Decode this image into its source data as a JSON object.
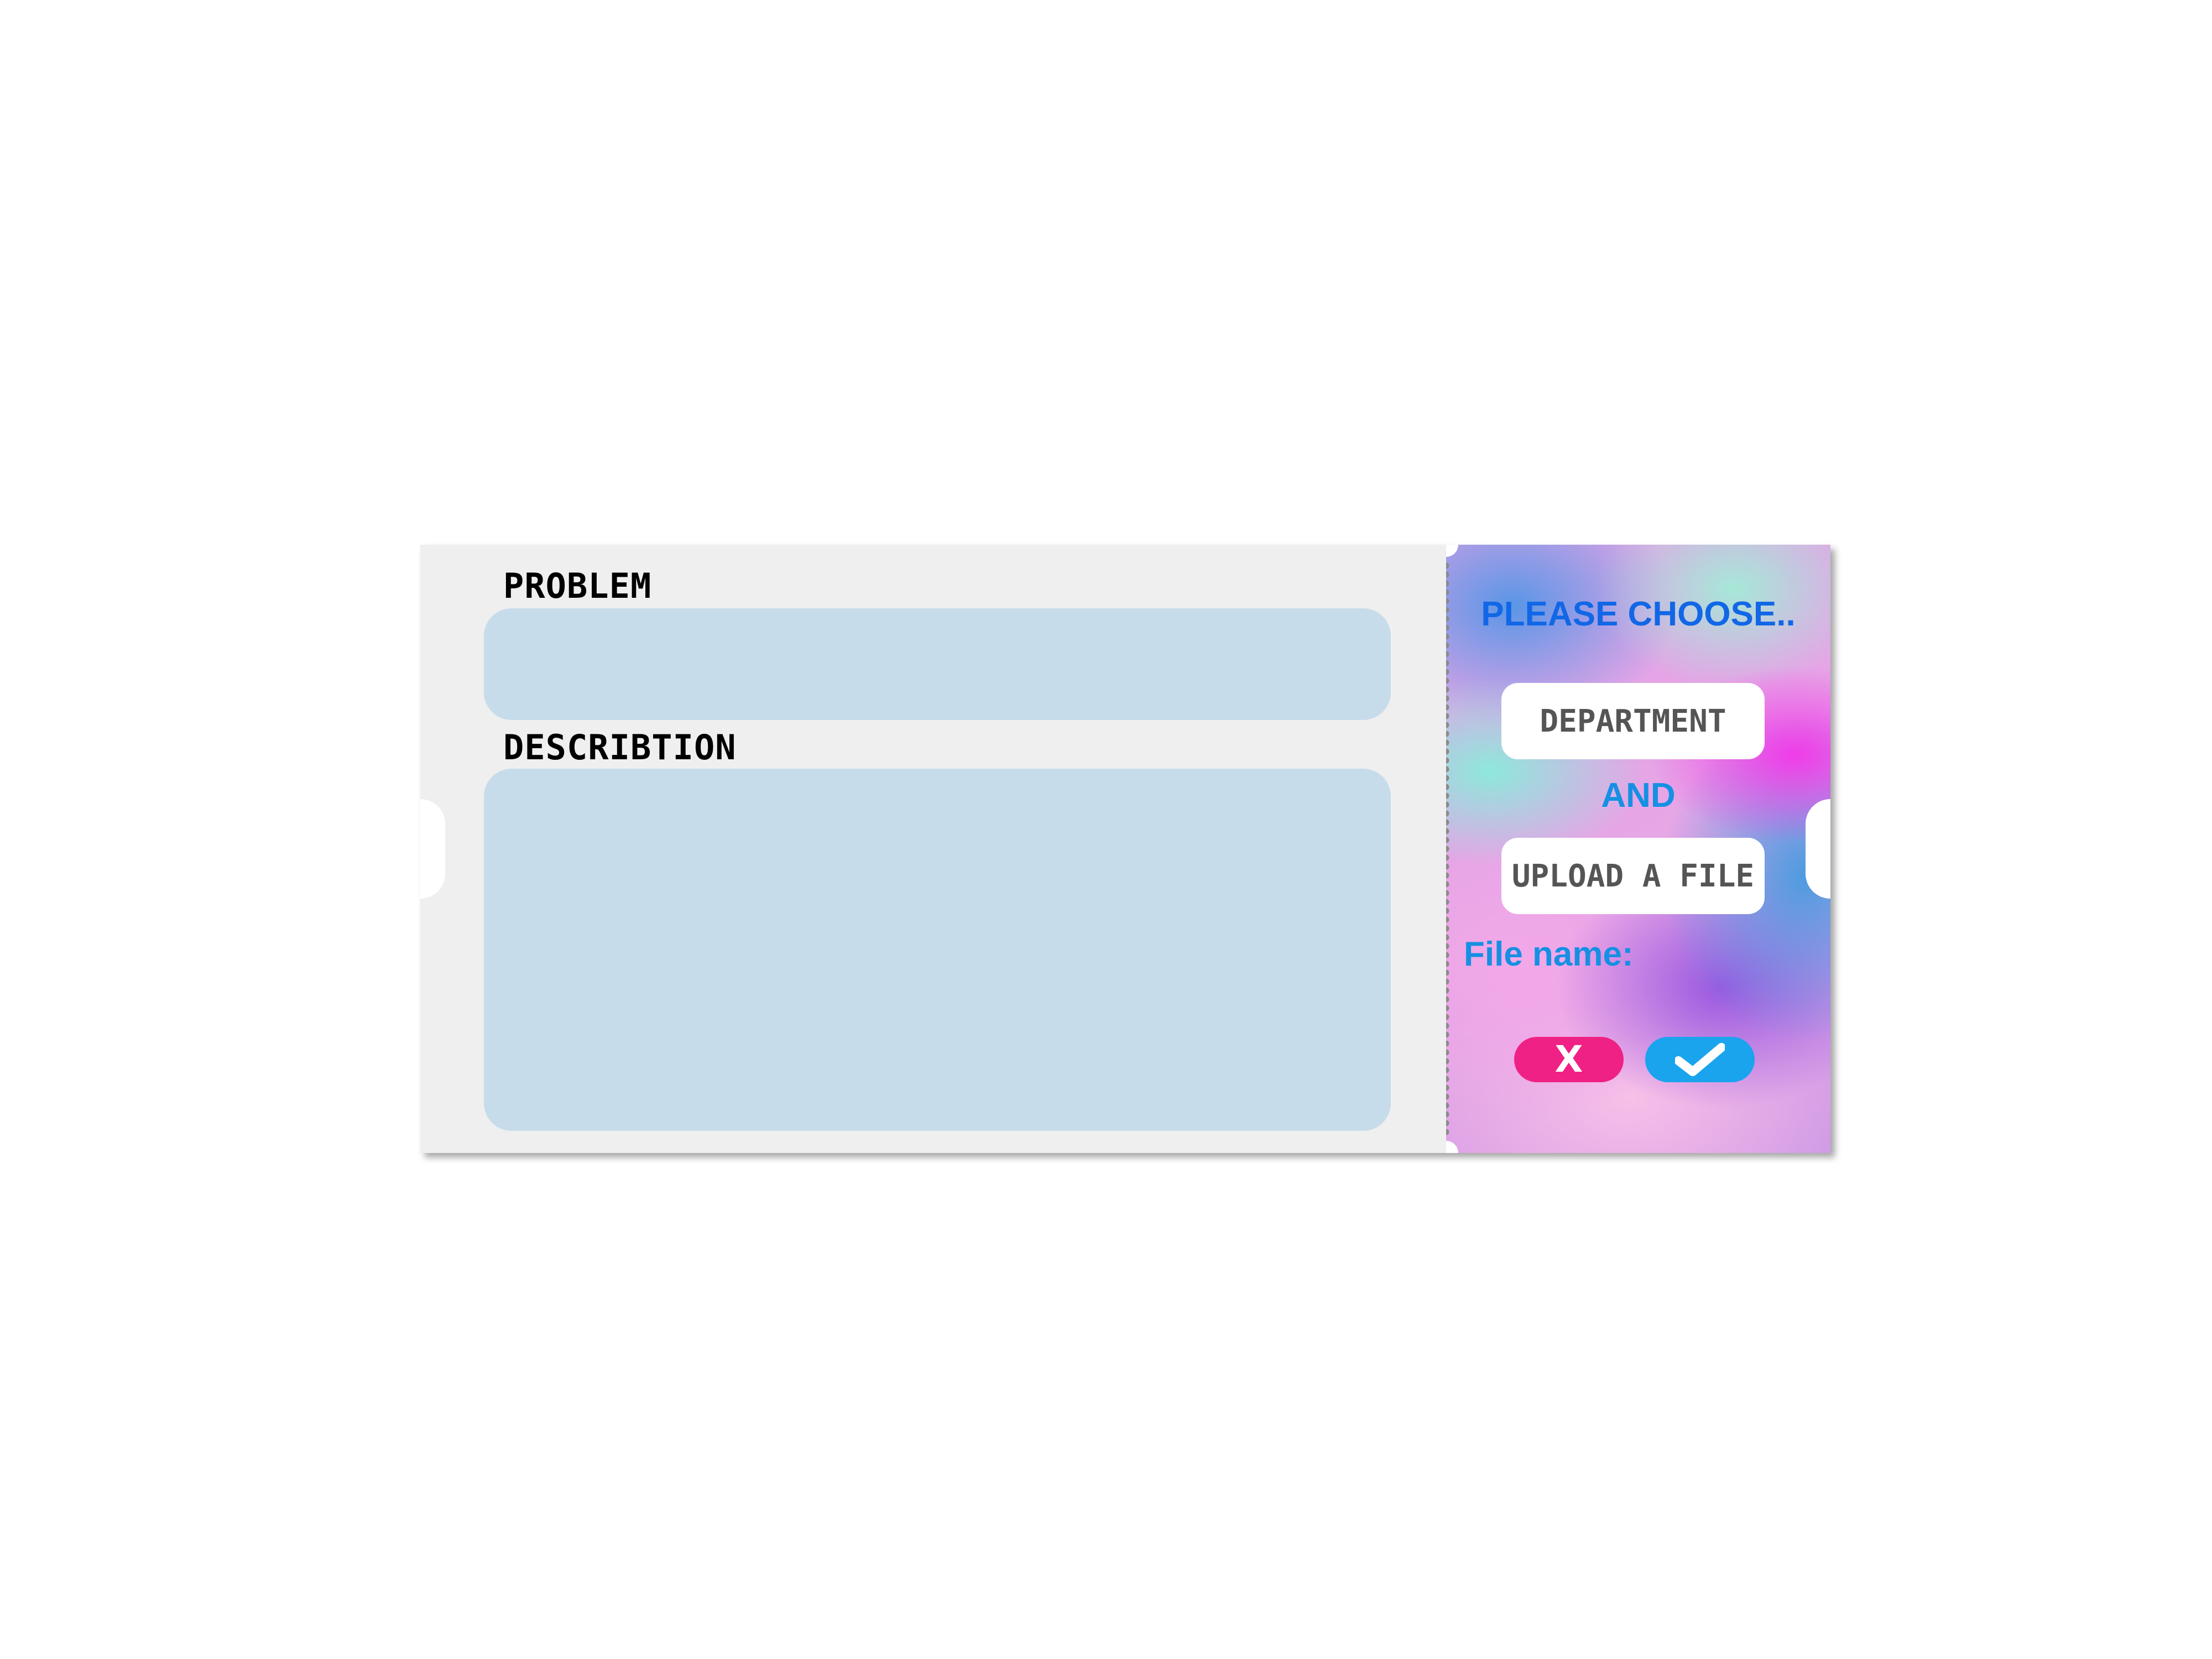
{
  "form": {
    "problem_label": "PROBLEM",
    "description_label": "DESCRIBTION",
    "problem_value": "",
    "description_value": ""
  },
  "sidebar": {
    "heading": "PLEASE CHOOSE..",
    "department_button": "DEPARTMENT",
    "and_label": "AND",
    "upload_button": "UPLOAD A FILE",
    "file_name_label": "File name:",
    "file_name_value": "",
    "cancel_label": "X",
    "confirm_icon": "checkmark-icon"
  },
  "colors": {
    "field_bg": "#c7dcea",
    "heading_blue": "#1167e6",
    "accent_blue": "#1590e3",
    "cancel_pink": "#f02184",
    "confirm_blue": "#1aa4ee"
  }
}
